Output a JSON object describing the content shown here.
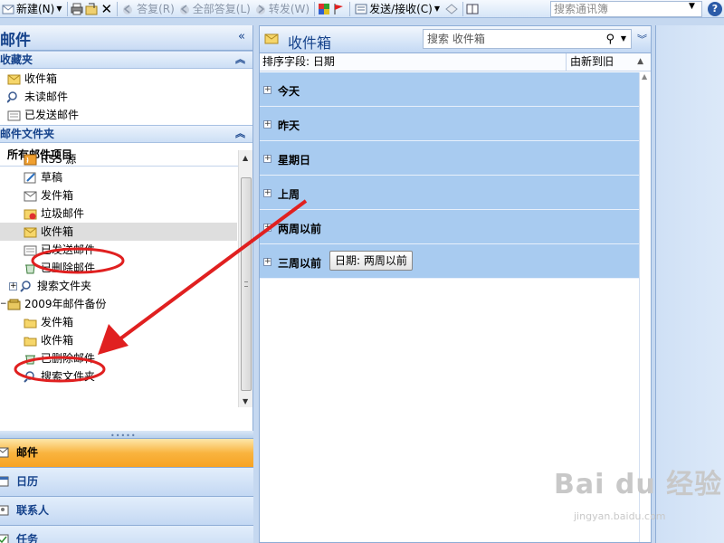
{
  "toolbar": {
    "new_label": "新建(N)",
    "reply_label": "答复(R)",
    "reply_all_label": "全部答复(L)",
    "forward_label": "转发(W)",
    "send_receive_label": "发送/接收(C)",
    "search_placeholder": "搜索通讯簿",
    "help_label": "?"
  },
  "nav": {
    "title": "邮件",
    "favorites": {
      "header": "收藏夹",
      "items": [
        "收件箱",
        "未读邮件",
        "已发送邮件"
      ]
    },
    "folders": {
      "header": "邮件文件夹",
      "all_items": "所有邮件项目",
      "tree": [
        {
          "label": "RSS 源",
          "icon": "rss-icon"
        },
        {
          "label": "草稿",
          "icon": "draft-icon"
        },
        {
          "label": "发件箱",
          "icon": "outbox-icon"
        },
        {
          "label": "垃圾邮件",
          "icon": "junk-icon"
        },
        {
          "label": "收件箱",
          "icon": "inbox-icon",
          "selected": true
        },
        {
          "label": "已发送邮件",
          "icon": "sent-icon"
        },
        {
          "label": "已删除邮件",
          "icon": "deleted-icon"
        },
        {
          "label": "搜索文件夹",
          "icon": "search-folder-icon"
        },
        {
          "label": "2009年邮件备份",
          "icon": "archive-icon"
        },
        {
          "label": "发件箱",
          "icon": "folder-icon"
        },
        {
          "label": "收件箱",
          "icon": "folder-icon"
        },
        {
          "label": "已删除邮件",
          "icon": "deleted-icon"
        },
        {
          "label": "搜索文件夹",
          "icon": "search-folder-icon"
        }
      ]
    },
    "buttons": [
      {
        "label": "邮件",
        "active": true
      },
      {
        "label": "日历",
        "active": false
      },
      {
        "label": "联系人",
        "active": false
      },
      {
        "label": "任务",
        "active": false
      }
    ]
  },
  "main": {
    "title": "收件箱",
    "search_placeholder": "搜索 收件箱",
    "sort_by": "排序字段: 日期",
    "sort_order": "由新到旧",
    "groups": [
      "今天",
      "昨天",
      "星期日",
      "上周",
      "两周以前",
      "三周以前"
    ],
    "tooltip": "日期: 两周以前"
  },
  "watermark": {
    "brand": "Bai du 经验",
    "url": "jingyan.baidu.com"
  },
  "colors": {
    "accent": "#15428b",
    "group_bg": "#a8cbf0",
    "annotation": "#e02020"
  }
}
